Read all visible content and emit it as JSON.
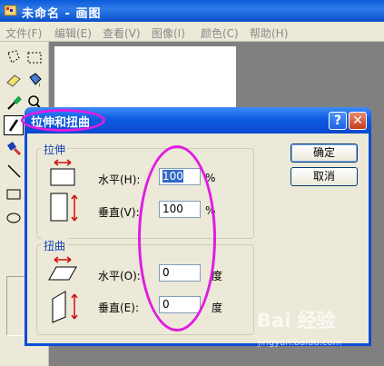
{
  "app": {
    "title": "未命名 - 画图",
    "menu": [
      "文件(F)",
      "编辑(E)",
      "查看(V)",
      "图像(I)",
      "颜色(C)",
      "帮助(H)"
    ]
  },
  "tools": [
    {
      "name": "free-select-icon"
    },
    {
      "name": "rect-select-icon"
    },
    {
      "name": "eraser-icon"
    },
    {
      "name": "fill-icon"
    },
    {
      "name": "color-picker-icon"
    },
    {
      "name": "magnifier-icon"
    },
    {
      "name": "pencil-icon"
    },
    {
      "name": "brush-icon"
    },
    {
      "name": "airbrush-icon"
    },
    {
      "name": "text-icon"
    },
    {
      "name": "line-icon"
    },
    {
      "name": "curve-icon"
    },
    {
      "name": "rectangle-icon"
    },
    {
      "name": "polygon-icon"
    },
    {
      "name": "ellipse-icon"
    },
    {
      "name": "rounded-rect-icon"
    }
  ],
  "dialog": {
    "title": "拉伸和扭曲",
    "help": "?",
    "close": "✕",
    "stretch": {
      "label": "拉伸",
      "horizontal_label": "水平(H):",
      "horizontal_value": "100",
      "horizontal_unit": "%",
      "vertical_label": "垂直(V):",
      "vertical_value": "100",
      "vertical_unit": "%"
    },
    "skew": {
      "label": "扭曲",
      "horizontal_label": "水平(O):",
      "horizontal_value": "0",
      "horizontal_unit": "度",
      "vertical_label": "垂直(E):",
      "vertical_value": "0",
      "vertical_unit": "度"
    },
    "ok": "确定",
    "cancel": "取消"
  },
  "watermark": {
    "brand": "Bai 经验",
    "url": "jingyan.baidu.com"
  },
  "colors": {
    "annotation": "#e11ce1",
    "title_bar": "#0a5bd8",
    "dialog_face": "#ece9d8"
  }
}
